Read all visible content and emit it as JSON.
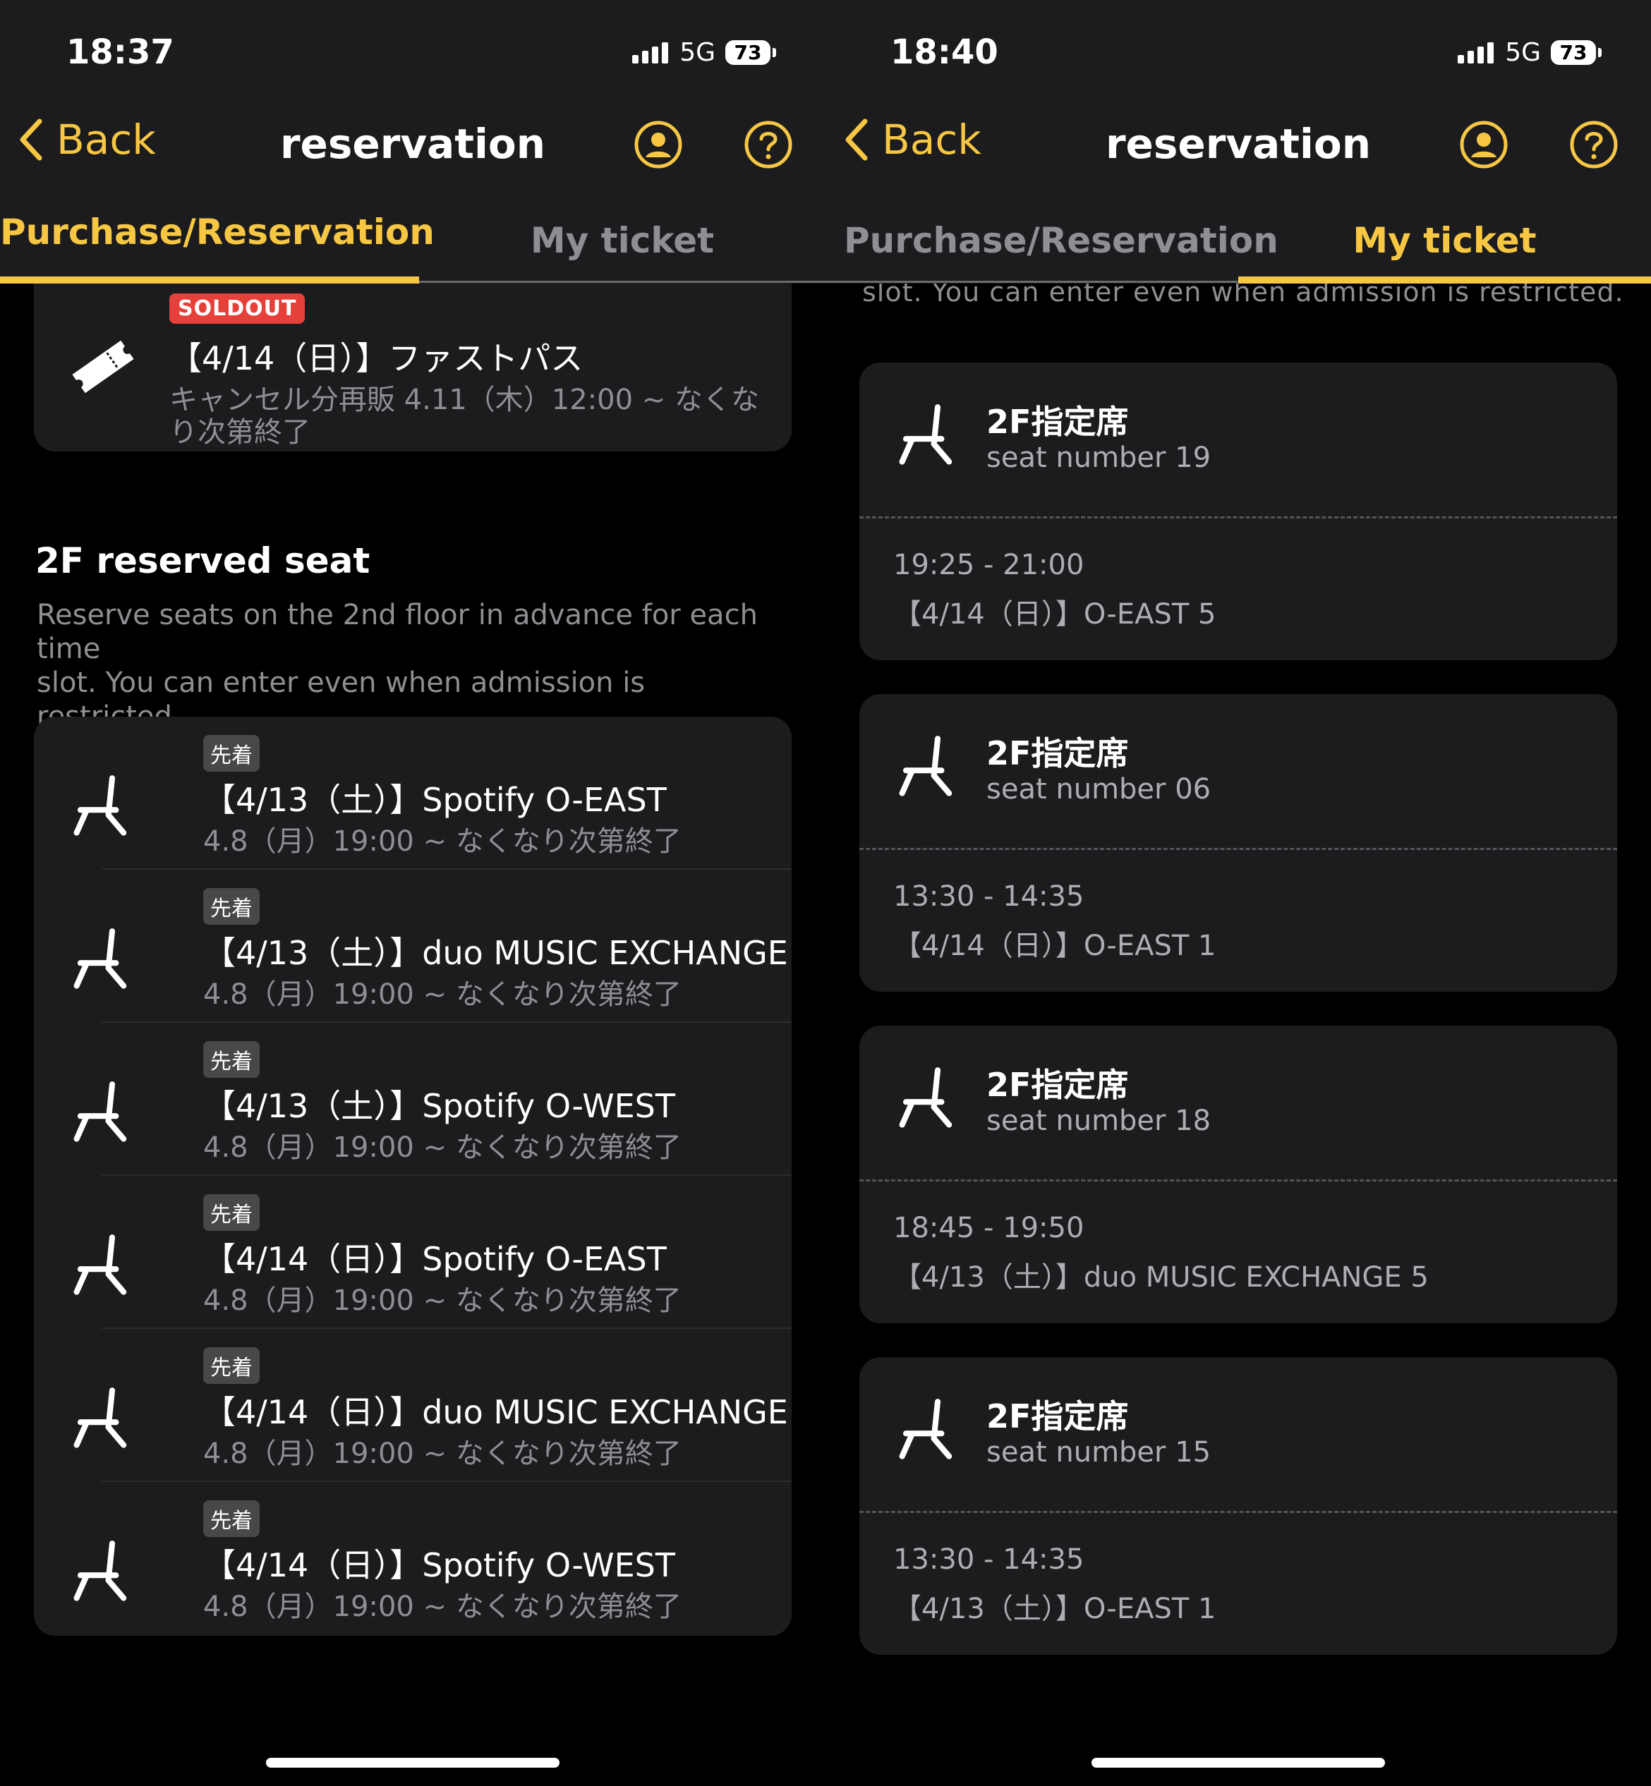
{
  "nav": {
    "back": "Back",
    "title": "reservation"
  },
  "tabs": {
    "purchase": "Purchase/Reservation",
    "my_ticket": "My ticket"
  },
  "colors": {
    "accent": "#f7c744",
    "soldout": "#e5403a",
    "card": "#1c1c1e"
  },
  "left": {
    "status": {
      "time": "18:37",
      "network": "5G",
      "battery": "73"
    },
    "fastpass": {
      "badge": "SOLDOUT",
      "title": "【4/14（日）】ファストパス",
      "sub_line1": "キャンセル分再販 4.11（木）12:00 ~ なくな",
      "sub_line2": "り次第終了",
      "icon": "ticket-icon"
    },
    "section": {
      "title": "2F reserved seat",
      "desc_line1": "Reserve seats on the 2nd floor in advance for each time",
      "desc_line2": "slot. You can enter even when admission is restricted."
    },
    "seats": [
      {
        "tag": "先着",
        "title": "【4/13（土）】Spotify O-EAST",
        "sub": "4.8（月）19:00 ~ なくなり次第終了"
      },
      {
        "tag": "先着",
        "title": "【4/13（土）】duo MUSIC EXCHANGE",
        "sub": "4.8（月）19:00 ~ なくなり次第終了"
      },
      {
        "tag": "先着",
        "title": "【4/13（土）】Spotify O-WEST",
        "sub": "4.8（月）19:00 ~ なくなり次第終了"
      },
      {
        "tag": "先着",
        "title": "【4/14（日）】Spotify O-EAST",
        "sub": "4.8（月）19:00 ~ なくなり次第終了"
      },
      {
        "tag": "先着",
        "title": "【4/14（日）】duo MUSIC EXCHANGE",
        "sub": "4.8（月）19:00 ~ なくなり次第終了"
      },
      {
        "tag": "先着",
        "title": "【4/14（日）】Spotify O-WEST",
        "sub": "4.8（月）19:00 ~ なくなり次第終了"
      }
    ]
  },
  "right": {
    "status": {
      "time": "18:40",
      "network": "5G",
      "battery": "73"
    },
    "cut_text": "slot. You can enter even when admission is restricted.",
    "tickets": [
      {
        "title": "2F指定席",
        "seat": "seat number 19",
        "time": "19:25 - 21:00",
        "venue": "【4/14（日）】O-EAST 5"
      },
      {
        "title": "2F指定席",
        "seat": "seat number 06",
        "time": "13:30 - 14:35",
        "venue": "【4/14（日）】O-EAST 1"
      },
      {
        "title": "2F指定席",
        "seat": "seat number 18",
        "time": "18:45 - 19:50",
        "venue": "【4/13（土）】duo MUSIC EXCHANGE 5"
      },
      {
        "title": "2F指定席",
        "seat": "seat number 15",
        "time": "13:30 - 14:35",
        "venue": "【4/13（土）】O-EAST 1"
      }
    ]
  }
}
